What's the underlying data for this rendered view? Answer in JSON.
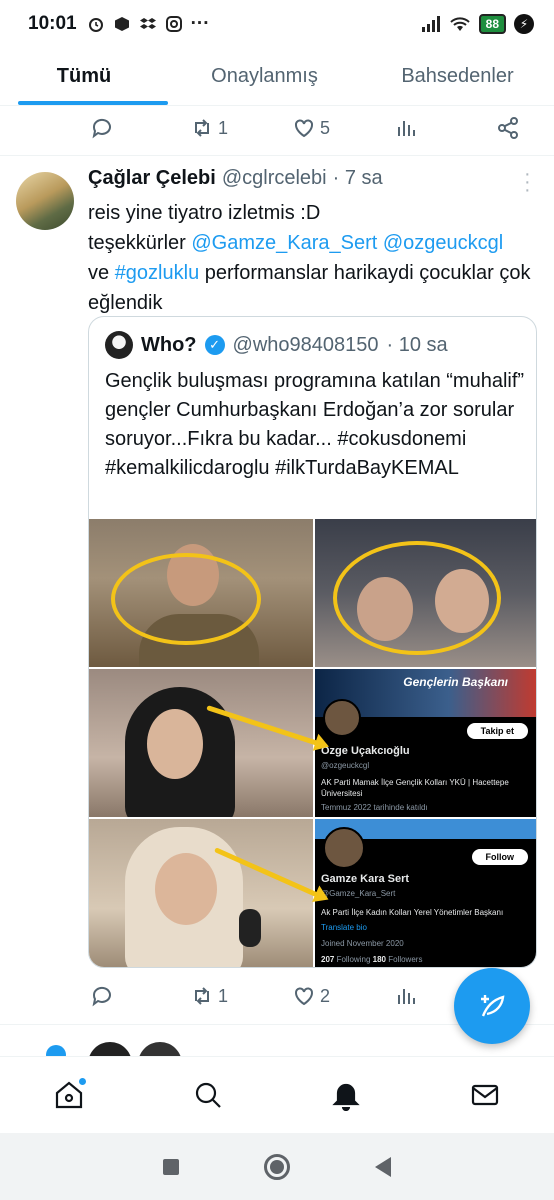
{
  "status_bar": {
    "time": "10:01",
    "icons": [
      "alarm-icon",
      "box-icon",
      "dropbox-icon",
      "instagram-icon",
      "more-dots-icon"
    ],
    "more": "···",
    "battery": "88",
    "right_icons": [
      "signal-icon",
      "wifi-icon",
      "battery-icon",
      "charging-icon"
    ]
  },
  "tabs": [
    {
      "label": "Tümü",
      "active": true
    },
    {
      "label": "Onaylanmış",
      "active": false
    },
    {
      "label": "Bahsedenler",
      "active": false
    }
  ],
  "prev_tweet_actions": {
    "reply": "",
    "retweet": "1",
    "like": "5"
  },
  "tweet": {
    "display_name": "Çağlar Çelebi",
    "handle": "@cglrcelebi",
    "time": "· 7 sa",
    "text_1": "reis yine tiyatro izletmis :D",
    "text_2": "teşekkürler ",
    "mention_1": "@Gamze_Kara_Sert",
    "mention_2": "@ozgeuckcgl",
    "text_3": "ve ",
    "hashtag_1": "#gozluklu",
    "text_4": " performanslar harikaydi çocuklar çok eğlendik",
    "actions": {
      "reply": "",
      "retweet": "1",
      "like": "2"
    }
  },
  "quote": {
    "display_name": "Who?",
    "verified_mark": "✓",
    "handle": "@who98408150",
    "time": "· 10 sa",
    "text": "Gençlik buluşması programına katılan “muhalif” gençler Cumhurbaşkanı Erdoğan’a zor sorular soruyor...Fıkra bu kadar... #cokusdonemi #kemalkilicdaroglu #ilkTurdaBayKEMAL",
    "image": {
      "banner_text": "Gençlerin Başkanı",
      "profile_1": {
        "name": "Özge Uçakcıoğlu",
        "handle": "@ozgeuckcgl",
        "button": "Takip et",
        "bio": "AK Parti Mamak İlçe Gençlik Kolları YKÜ | Hacettepe Üniversitesi",
        "joined": "Temmuz 2022 tarihinde katıldı"
      },
      "profile_2": {
        "name": "Gamze Kara Sert",
        "handle": "@Gamze_Kara_Sert",
        "button": "Follow",
        "bio": "Ak Parti İlçe Kadın Kolları Yerel Yönetimler Başkanı",
        "translate": "Translate bio",
        "joined": "Joined November 2020",
        "following_count": "207",
        "following_label": "Following",
        "followers_count": "180",
        "followers_label": "Followers"
      }
    }
  },
  "colors": {
    "accent": "#1d9bf0",
    "text": "#0f1419",
    "muted": "#536471",
    "highlight": "#f3c318"
  },
  "bottom_nav": [
    "home-icon",
    "search-icon",
    "notifications-icon",
    "messages-icon"
  ]
}
